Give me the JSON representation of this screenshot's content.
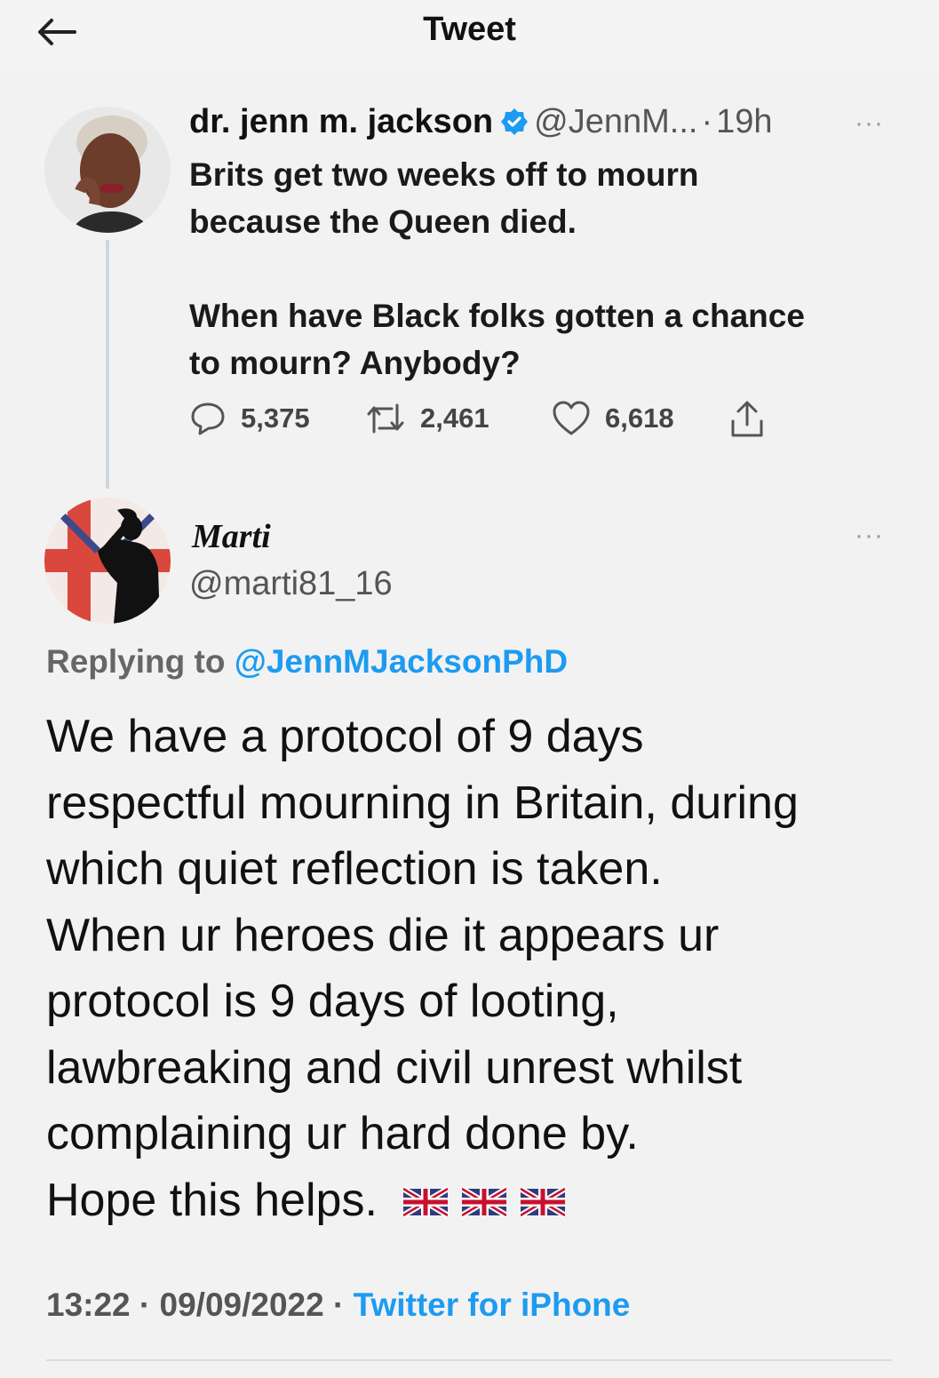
{
  "header": {
    "title": "Tweet",
    "back_icon": "back-arrow-icon"
  },
  "original_tweet": {
    "display_name": "dr. jenn m. jackson",
    "verified_icon": "verified-badge-icon",
    "handle": "@JennM...",
    "time": "19h",
    "separator": "·",
    "more": "···",
    "text_lines": [
      "Brits get two weeks off to mourn",
      "because the Queen died.",
      "When have Black folks gotten a chance",
      "to mourn? Anybody?"
    ],
    "actions": {
      "replies": "5,375",
      "retweets": "2,461",
      "likes": "6,618"
    }
  },
  "reply_tweet": {
    "display_name": "Marti",
    "handle": "@marti81_16",
    "more": "···",
    "replying_prefix": "Replying to",
    "replying_to": "@JennMJacksonPhD",
    "body_lines": [
      "We have a protocol of 9 days",
      "respectful mourning in Britain, during",
      "which quiet reflection is taken.",
      "When ur heroes die it appears ur",
      "protocol is 9 days of looting,",
      "lawbreaking and civil unrest whilst",
      "complaining ur hard done by.",
      "Hope this helps."
    ],
    "flags": [
      "uk-flag-icon",
      "uk-flag-icon",
      "uk-flag-icon"
    ],
    "time": "13:22",
    "date": "09/09/2022",
    "separator": "·",
    "client": "Twitter for iPhone"
  },
  "colors": {
    "accent": "#1d9bf0",
    "muted": "#555555",
    "background": "#f2f2f2"
  }
}
